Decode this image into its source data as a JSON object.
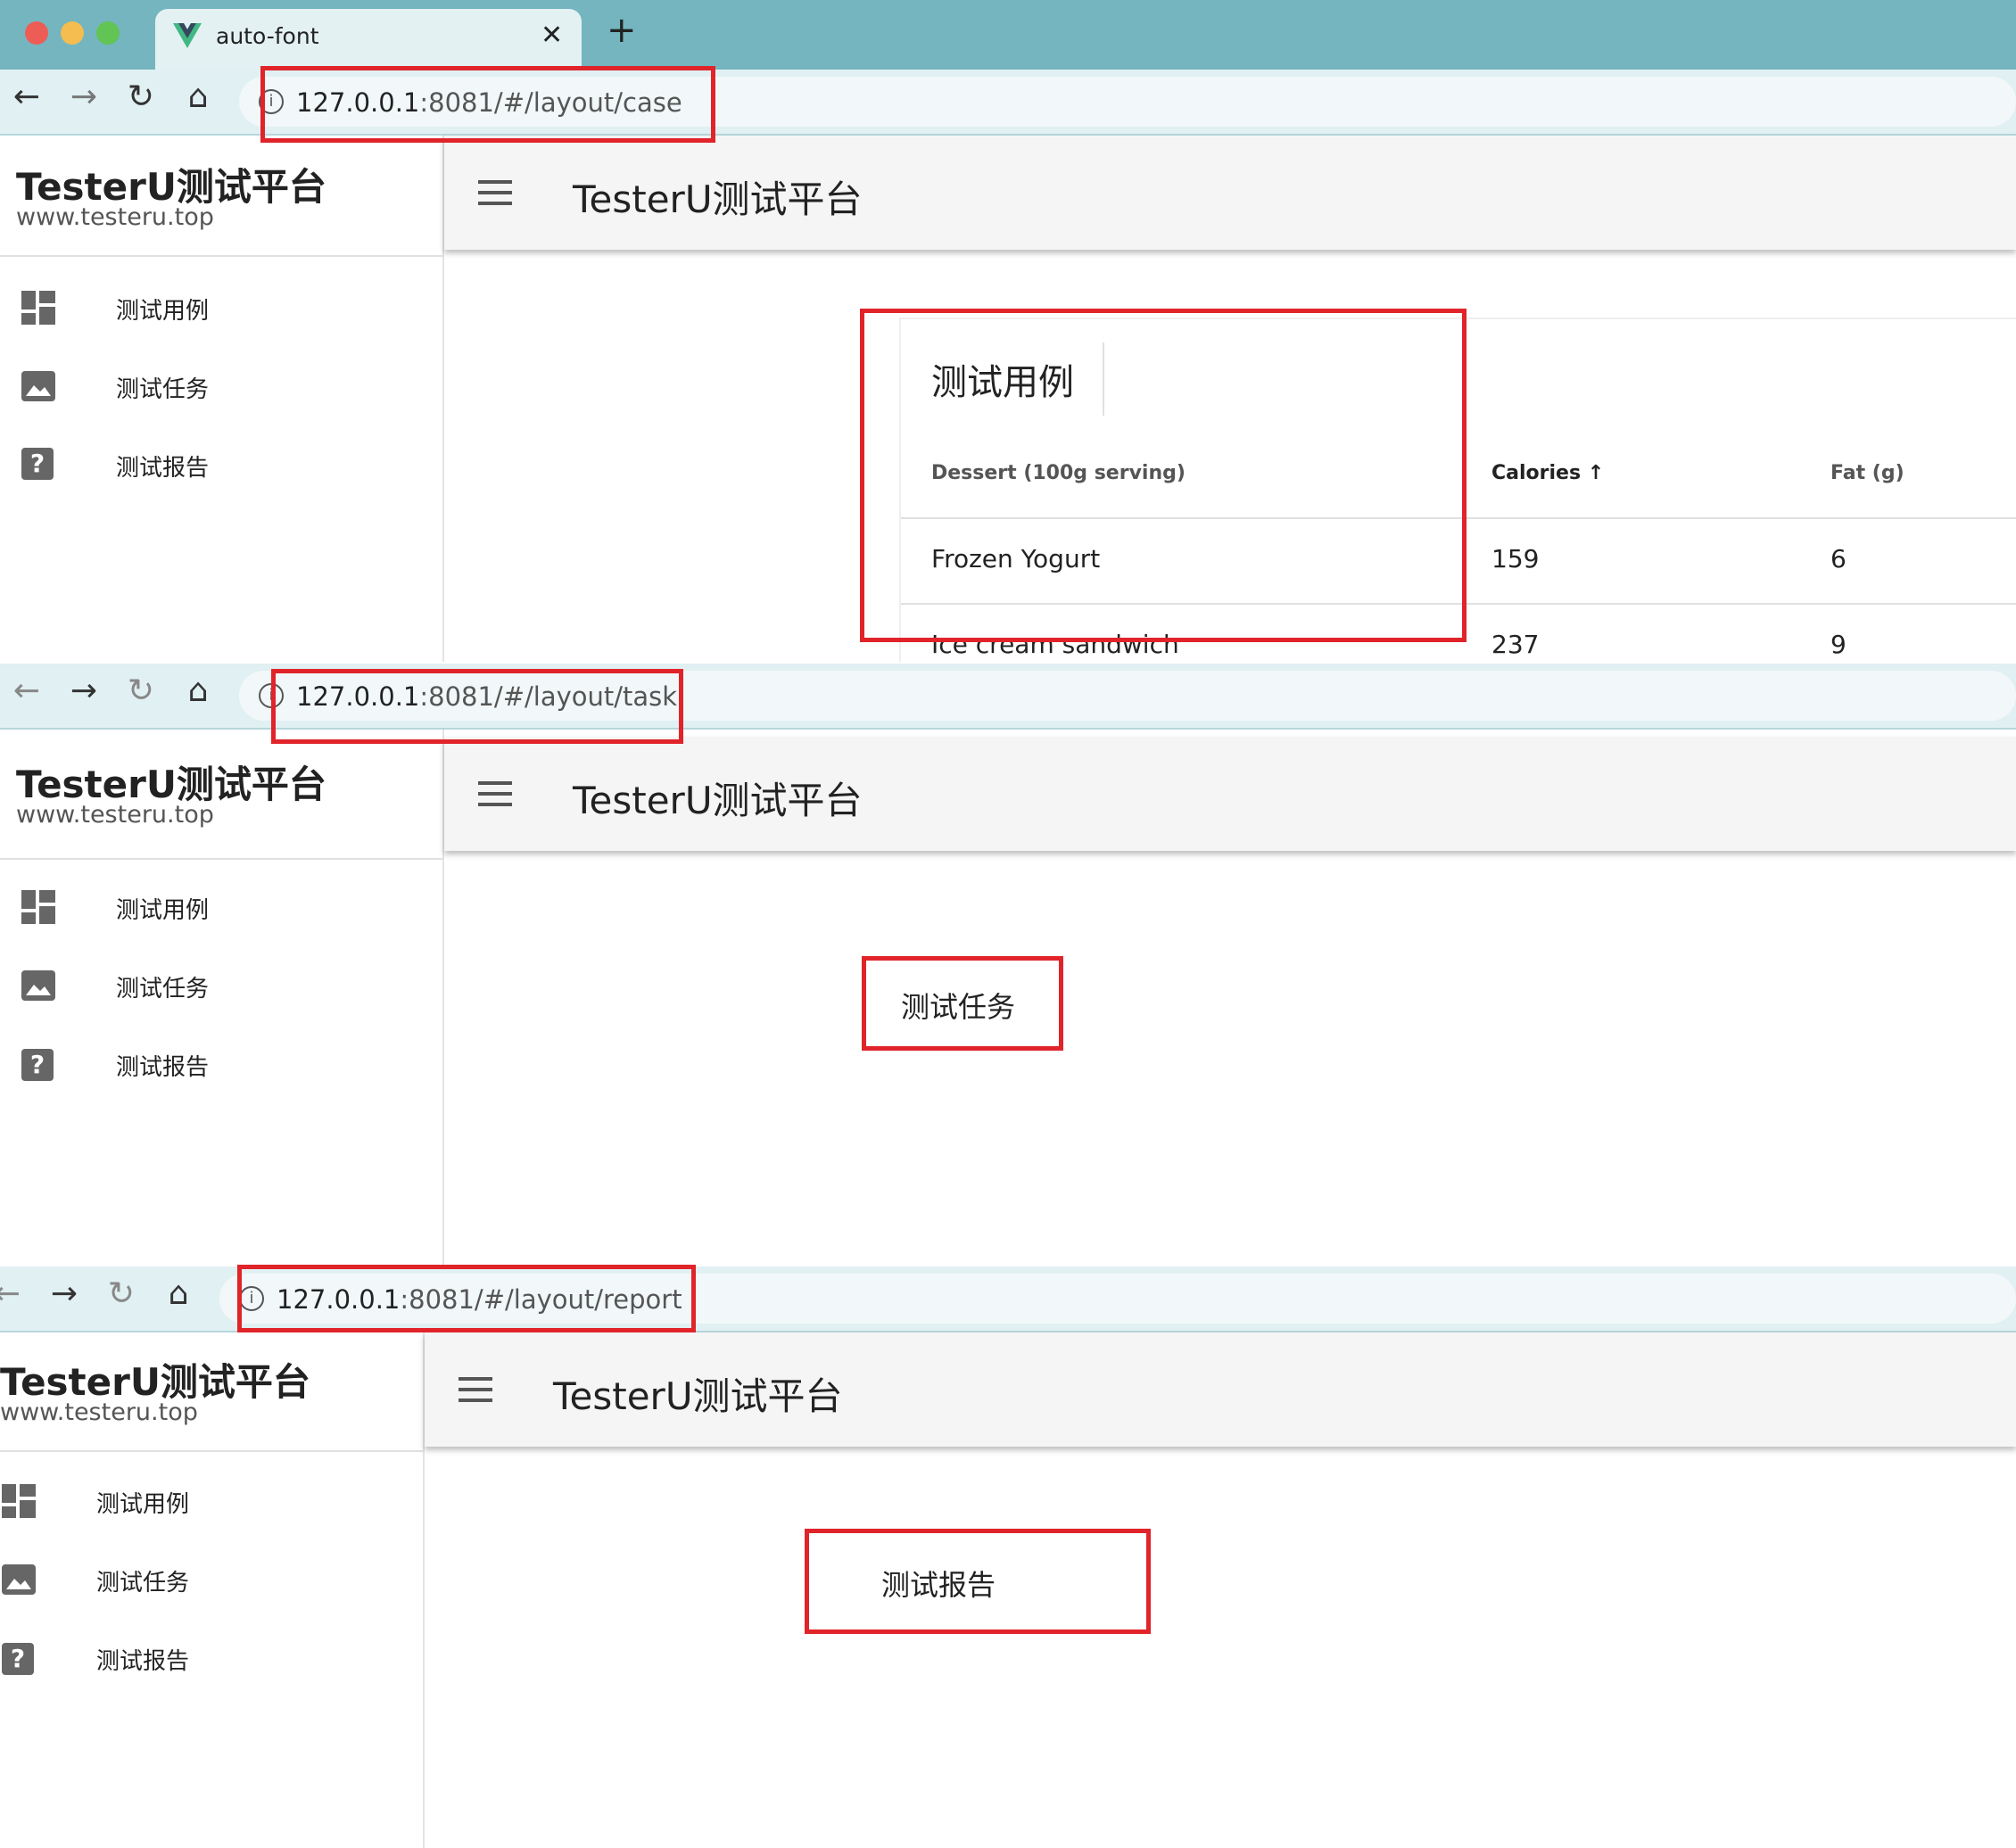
{
  "browser": {
    "tab_title": "auto-font",
    "new_tab_icon": "plus-icon",
    "close_tab_icon": "close-icon"
  },
  "panels": [
    {
      "url_host": "127.0.0.1",
      "url_rest": ":8081/#/layout/case",
      "page_content": "测试用例"
    },
    {
      "url_host": "127.0.0.1",
      "url_rest": ":8081/#/layout/task",
      "page_content": "测试任务"
    },
    {
      "url_host": "127.0.0.1",
      "url_rest": ":8081/#/layout/report",
      "page_content": "测试报告"
    }
  ],
  "app": {
    "brand_title": "TesterU测试平台",
    "brand_subtitle": "www.testeru.top",
    "header_title": "TesterU测试平台",
    "menu": [
      {
        "label": "测试用例",
        "icon": "dashboard-icon"
      },
      {
        "label": "测试任务",
        "icon": "image-icon"
      },
      {
        "label": "测试报告",
        "icon": "help-icon"
      }
    ]
  },
  "case_table": {
    "title": "测试用例",
    "headers": [
      "Dessert (100g serving)",
      "Calories",
      "Fat (g)"
    ],
    "sort_icon": "arrow-up-icon",
    "rows": [
      [
        "Frozen Yogurt",
        "159",
        "6"
      ],
      [
        "Ice cream sandwich",
        "237",
        "9"
      ]
    ]
  },
  "colors": {
    "tab_bar": "#74b5bf",
    "toolbar": "#e1f0f2",
    "annotation": "#e0242a",
    "vue_green": "#41b883"
  }
}
